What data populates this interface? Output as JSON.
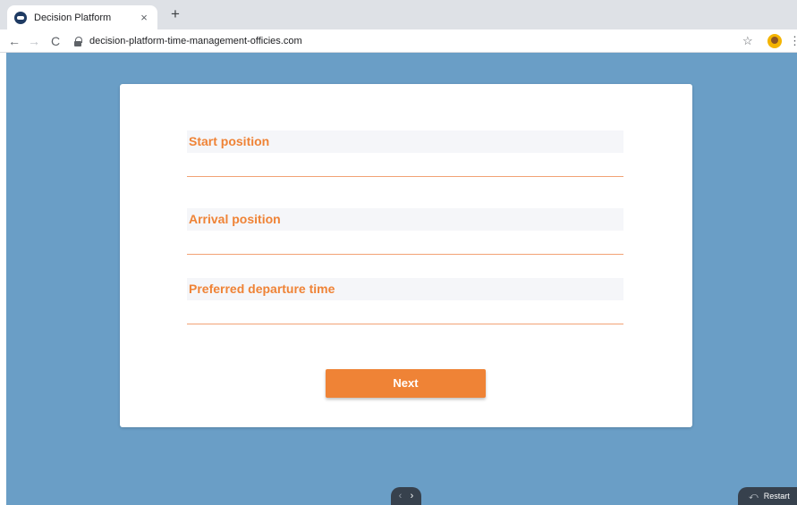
{
  "browser": {
    "tab_title": "Decision Platform",
    "tab_close": "×",
    "new_tab": "+",
    "url": "decision-platform-time-management-officies.com",
    "back": "←",
    "forward": "→",
    "reload": "C",
    "star": "☆",
    "menu": "⋮"
  },
  "form": {
    "fields": [
      {
        "label": "Start position",
        "value": ""
      },
      {
        "label": "Arrival position",
        "value": ""
      },
      {
        "label": "Preferred departure time",
        "value": ""
      }
    ],
    "next_label": "Next"
  },
  "footer": {
    "prev_arrow": "‹",
    "next_arrow": "›",
    "restart_icon": "⤺",
    "restart_label": "Restart"
  },
  "colors": {
    "accent": "#ef8336",
    "background": "#6a9ec6",
    "field_bg": "#f5f6f9",
    "footer_bg": "#37414d"
  }
}
